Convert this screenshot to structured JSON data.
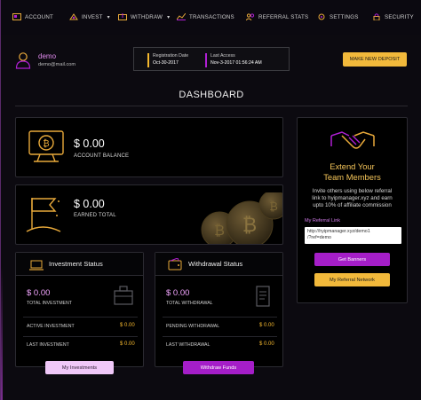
{
  "nav": {
    "account": "ACCOUNT",
    "invest": "INVEST",
    "withdraw": "WITHDRAW",
    "transactions": "TRANSACTIONS",
    "referral_stats": "REFERRAL STATS",
    "settings": "SETTINGS",
    "security": "SECURITY"
  },
  "user": {
    "name": "demo",
    "email": "demo@mail.com"
  },
  "dates": {
    "registration_label": "Registration Date",
    "registration_value": "Oct-30-2017",
    "last_access_label": "Last Access",
    "last_access_value": "Nov-3-2017 01:56:24 AM"
  },
  "make_deposit": "MAKE NEW DEPOSIT",
  "page_title": "DASHBOARD",
  "balance": {
    "amount": "$ 0.00",
    "label": "ACCOUNT BALANCE"
  },
  "earned": {
    "amount": "$ 0.00",
    "label": "EARNED TOTAL"
  },
  "investment": {
    "title": "Investment Status",
    "amount": "$ 0.00",
    "amount_label": "TOTAL INVESTMENT",
    "row1_label": "ACTIVE INVESTMENT",
    "row1_value": "$ 0.00",
    "row2_label": "LAST INVESTMENT",
    "row2_value": "$ 0.00",
    "button": "My Investments"
  },
  "withdrawal": {
    "title": "Withdrawal Status",
    "amount": "$ 0.00",
    "amount_label": "TOTAL WITHDRAWAL",
    "row1_label": "PENDING WITHDRAWAL",
    "row1_value": "$ 0.00",
    "row2_label": "LAST WITHDRAWAL",
    "row2_value": "$ 0.00",
    "button": "Withdraw Funds"
  },
  "team": {
    "title_line1": "Extend Your",
    "title_line2": "Team Members",
    "text_line1": "Invite others using below referral",
    "text_line2": "link to hyipmanager.xyz and earn",
    "text_line3": "upto 10% of affiliate commission",
    "ref_label": "My Referral Link",
    "ref_link_line1": "http://hyipmanager.xyz/demo1",
    "ref_link_line2": "/?ref=demo",
    "btn_banners": "Get Banners",
    "btn_network": "My Referral Network"
  },
  "colors": {
    "accent_gold": "#f5b82e",
    "accent_purple": "#b01fd4",
    "pink": "#f3a5ff"
  },
  "icons": [
    "account-icon",
    "invest-icon",
    "withdraw-icon",
    "transactions-icon",
    "referral-icon",
    "settings-icon",
    "security-icon",
    "user-icon",
    "monitor-bitcoin-icon",
    "flag-icon",
    "bitcoin-coins-icon",
    "laptop-icon",
    "wallet-icon",
    "briefcase-icon",
    "handshake-icon"
  ]
}
